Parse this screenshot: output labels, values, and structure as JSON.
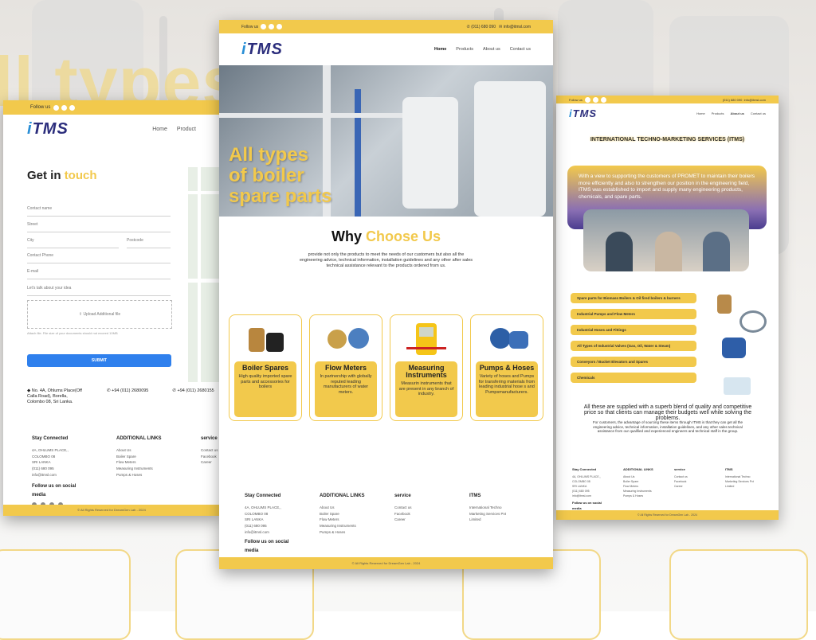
{
  "background": {
    "big_text": "ll types"
  },
  "topbar": {
    "follow": "Follow us",
    "phone": "(011) 680 090",
    "email": "info@itmsl.com"
  },
  "logo": "ITMS",
  "nav_left": [
    "Home",
    "Product"
  ],
  "nav": [
    "Home",
    "Products",
    "About us",
    "Contact us"
  ],
  "contact": {
    "title_a": "Get in",
    "title_b": "touch",
    "fields": {
      "name": "Contact name",
      "street": "Street",
      "city": "City",
      "postcode": "Postcode",
      "phone": "Contact Phone",
      "email": "E-mail",
      "idea": "Let's talk about your idea",
      "upload": "Upload Additional file",
      "upload_note": "Attach file. File size of your documents should not exceed 10MB"
    },
    "submit": "SUBMIT",
    "address": "No. 4A, Ohlums Place(Off Calla Road), Borella, Colombo 08, Sri Lanka.",
    "phone1": "+94 (011) 2680095",
    "phone2": "+94 (011) 2680155"
  },
  "footer": {
    "stay": "Stay Connected",
    "addr": [
      "4A, OHLUMS PLACE,,",
      "COLOMBO 08",
      "SRI LANKA",
      "(011) 680 095",
      "info@itmsl.com"
    ],
    "follow_social": "Follow us on social media",
    "additional": "ADDITIONAL LINKS",
    "links": [
      "About Us",
      "Boiler Spare",
      "Flow Meters",
      "Measuring Instruments",
      "Pumps & Hoses"
    ],
    "service": "service",
    "service_links": [
      "Contact us",
      "Facebook",
      "Career"
    ],
    "itms": "ITMS",
    "itms_text": "International Techno Marketing Services Pvt Limited",
    "copyright": "© All Rights Reserved for DreamGen Lab - 2024"
  },
  "hero": {
    "line1": "All types",
    "line2": "of boiler",
    "line3": "spare parts"
  },
  "why": {
    "a": "Why",
    "b": "Choose Us",
    "text": "provide not only the products to meet the needs of our customers but also all the engineering advice, technical information, installation guidelines and any other after sales technical assistance relevant to the products ordered from us."
  },
  "cards": [
    {
      "title": "Boiler Spares",
      "desc": "High quality imported spare parts and accessories for boilers"
    },
    {
      "title": "Flow Meters",
      "desc": "In partnership with globally reputed leading manufacturers of water meters."
    },
    {
      "title": "Measuring Instruments",
      "desc": "Measurin instruments that are present in any branch of industry."
    },
    {
      "title": "Pumps & Hoses",
      "desc": "Variety of hoses and Pumps for transfering materials from leading industrial hose s and Pumpsmanufacturers."
    }
  ],
  "about": {
    "title": "INTERNATIONAL TECHNO-MARKETING SERVICES (ITMS)",
    "banner": "With a view to supporting the customers of PROMET to maintain their boilers more efficiently and also to strengthen our position in the engineering field, ITMS was established to import and supply many engineering products, chemicals, and spare parts.",
    "list": [
      "Spare parts for Biomass Boilers & Oil fired boilers & burners",
      "Industrial Pumps and Flow Meters",
      "Industrial Hoses and Fittings",
      "All Types of Industrial Valves (Gas, Oil, Water & Steam)",
      "Conveyors / Bucket Elevators and Spares",
      "Chemicals"
    ],
    "para1": "All these are supplied with a superb blend of quality and competitive price so that clients can manage their budgets well while solving the problems.",
    "para2": "For customers, the advantage of sourcing these items through ITMS is that they can get all the engineering advice, technical information, installation guidelines, and any other sales technical assistance from our qualified and experienced engineers and technical staff in the group."
  },
  "colors": {
    "accent": "#f2c94c",
    "brand": "#2b2d7c",
    "submit": "#2f80ed"
  }
}
